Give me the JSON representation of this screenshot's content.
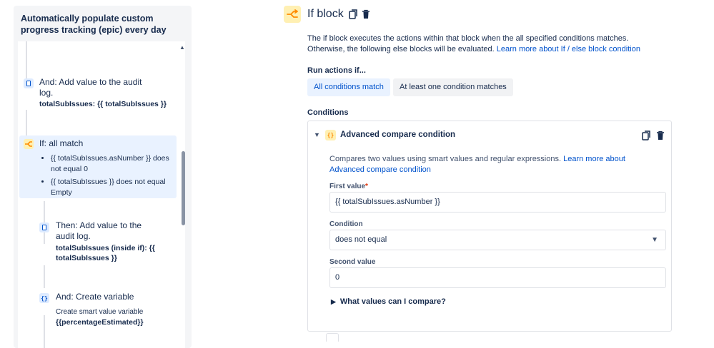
{
  "left_panel": {
    "rule_title": "Automatically populate custom progress tracking (epic) every day",
    "components": [
      {
        "icon": "audit-log-icon",
        "title": "And: Add value to the audit log.",
        "detail": "totalSubIssues: {{ totalSubIssues }}"
      },
      {
        "icon": "if-branch-icon",
        "title": "If: all match",
        "bullets": [
          "{{ totalSubIssues.asNumber }} does not equal 0",
          "{{ totalSubIssues }} does not equal Empty"
        ]
      },
      {
        "icon": "audit-log-icon",
        "title": "Then: Add value to the audit log.",
        "detail": "totalSubIssues (inside if): {{ totalSubIssues }}"
      },
      {
        "icon": "variable-icon",
        "title": "And: Create variable",
        "subtitle": "Create smart value variable",
        "detail": "{{percentageEstimated}}"
      }
    ]
  },
  "main": {
    "title": "If block",
    "description": "The if block executes the actions within that block when the all specified conditions matches. Otherwise, the following else blocks will be evaluated.",
    "description_link": "Learn more about If / else block condition",
    "run_actions_label": "Run actions if...",
    "tabs": [
      {
        "label": "All conditions match",
        "active": true
      },
      {
        "label": "At least one condition matches",
        "active": false
      }
    ],
    "conditions_label": "Conditions",
    "condition_card": {
      "title": "Advanced compare condition",
      "description": "Compares two values using smart values and regular expressions.",
      "description_link": "Learn more about Advanced compare condition",
      "first_value_label": "First value",
      "first_value_required": "*",
      "first_value": "{{ totalSubIssues.asNumber }}",
      "condition_label": "Condition",
      "condition_value": "does not equal",
      "second_value_label": "Second value",
      "second_value": "0",
      "help_toggle": "What values can I compare?"
    }
  },
  "colors": {
    "accent": "#0052cc",
    "selected_bg": "#e9f2ff",
    "condition_icon_bg": "#fff0b3",
    "condition_icon_fg": "#ff8b00"
  }
}
